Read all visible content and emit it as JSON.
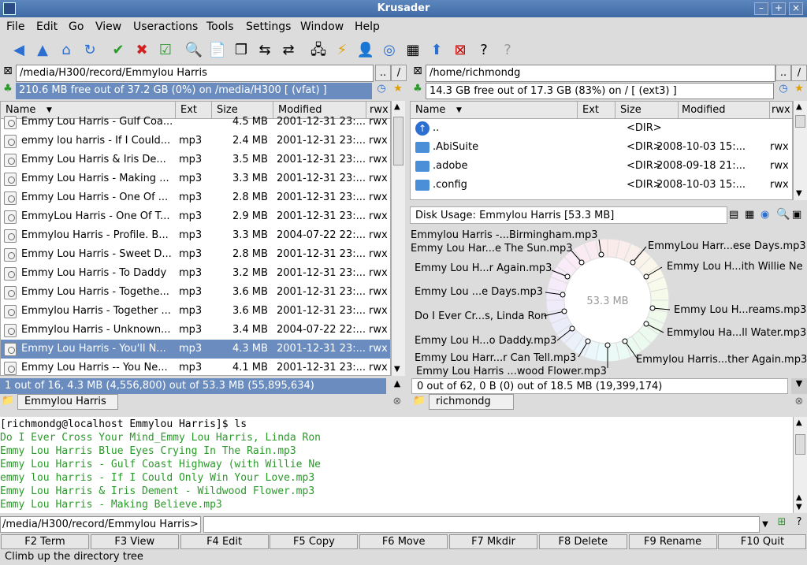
{
  "window": {
    "title": "Krusader"
  },
  "menu": [
    "File",
    "Edit",
    "Go",
    "View",
    "Useractions",
    "Tools",
    "Settings",
    "Window",
    "Help"
  ],
  "left": {
    "path": "/media/H300/record/Emmylou Harris",
    "free": "210.6 MB free out of 37.2 GB (0%) on /media/H300 [ (vfat) ]",
    "headers": {
      "name": "Name",
      "ext": "Ext",
      "size": "Size",
      "modified": "Modified",
      "rwx": "rwx"
    },
    "rows": [
      {
        "name": "Emmy Lou Harris - Gulf Coa...",
        "ext": "",
        "size": "4.5 MB",
        "modified": "2001-12-31 23:...",
        "rwx": "rwx"
      },
      {
        "name": "emmy lou harris - If I Could...",
        "ext": "mp3",
        "size": "2.4 MB",
        "modified": "2001-12-31 23:...",
        "rwx": "rwx"
      },
      {
        "name": "Emmy Lou Harris & Iris De...",
        "ext": "mp3",
        "size": "3.5 MB",
        "modified": "2001-12-31 23:...",
        "rwx": "rwx"
      },
      {
        "name": "Emmy Lou Harris - Making ...",
        "ext": "mp3",
        "size": "3.3 MB",
        "modified": "2001-12-31 23:...",
        "rwx": "rwx"
      },
      {
        "name": "Emmy Lou Harris - One Of ...",
        "ext": "mp3",
        "size": "2.8 MB",
        "modified": "2001-12-31 23:...",
        "rwx": "rwx"
      },
      {
        "name": "EmmyLou Harris - One Of T...",
        "ext": "mp3",
        "size": "2.9 MB",
        "modified": "2001-12-31 23:...",
        "rwx": "rwx"
      },
      {
        "name": "Emmylou Harris - Profile. B...",
        "ext": "mp3",
        "size": "3.3 MB",
        "modified": "2004-07-22 22:...",
        "rwx": "rwx"
      },
      {
        "name": "Emmy Lou Harris - Sweet D...",
        "ext": "mp3",
        "size": "2.8 MB",
        "modified": "2001-12-31 23:...",
        "rwx": "rwx"
      },
      {
        "name": "Emmy Lou Harris - To Daddy",
        "ext": "mp3",
        "size": "3.2 MB",
        "modified": "2001-12-31 23:...",
        "rwx": "rwx"
      },
      {
        "name": "Emmy Lou Harris - Togethe...",
        "ext": "mp3",
        "size": "3.6 MB",
        "modified": "2001-12-31 23:...",
        "rwx": "rwx"
      },
      {
        "name": "Emmylou Harris - Together ...",
        "ext": "mp3",
        "size": "3.6 MB",
        "modified": "2001-12-31 23:...",
        "rwx": "rwx"
      },
      {
        "name": "Emmylou Harris - Unknown...",
        "ext": "mp3",
        "size": "3.4 MB",
        "modified": "2004-07-22 22:...",
        "rwx": "rwx"
      },
      {
        "name": "Emmy Lou Harris -  You'll N...",
        "ext": "mp3",
        "size": "4.3 MB",
        "modified": "2001-12-31 23:...",
        "rwx": "rwx"
      },
      {
        "name": "Emmy Lou Harris -- You Ne...",
        "ext": "mp3",
        "size": "4.1 MB",
        "modified": "2001-12-31 23:...",
        "rwx": "rwx"
      }
    ],
    "status": "1 out of 16, 4.3 MB (4,556,800) out of 53.3 MB (55,895,634)",
    "tab": "Emmylou Harris"
  },
  "right": {
    "path": "/home/richmondg",
    "free": "14.3 GB free out of 17.3 GB (83%) on / [ (ext3) ]",
    "headers": {
      "name": "Name",
      "ext": "Ext",
      "size": "Size",
      "modified": "Modified",
      "rwx": "rwx"
    },
    "rows": [
      {
        "name": "..",
        "ext": "",
        "size": "<DIR>",
        "modified": "",
        "rwx": ""
      },
      {
        "name": ".AbiSuite",
        "ext": "",
        "size": "<DIR>",
        "modified": "2008-10-03 15:...",
        "rwx": "rwx"
      },
      {
        "name": ".adobe",
        "ext": "",
        "size": "<DIR>",
        "modified": "2008-09-18 21:...",
        "rwx": "rwx"
      },
      {
        "name": ".config",
        "ext": "",
        "size": "<DIR>",
        "modified": "2008-10-03 15:...",
        "rwx": "rwx"
      }
    ],
    "disk_usage": "Disk Usage: Emmylou Harris  [53.3 MB]",
    "pie_center": "53.3 MB",
    "pie_labels": [
      "Emmylou Harris -...Birmingham.mp3",
      "Emmy Lou Har...e The Sun.mp3",
      "Emmy Lou H...r Again.mp3",
      "Emmy Lou ...e Days.mp3",
      "Do I Ever Cr...s, Linda Ron",
      "Emmy Lou H...o Daddy.mp3",
      "Emmy Lou Harr...r Can Tell.mp3",
      "Emmy Lou Harris ...wood Flower.mp3",
      "EmmyLou Harr...ese Days.mp3",
      "Emmy Lou H...ith Willie Ne",
      "Emmy Lou H...reams.mp3",
      "Emmylou Ha...ll Water.mp3",
      "Emmylou Harris...ther Again.mp3"
    ],
    "status": "0 out of 62, 0 B (0) out of 18.5 MB (19,399,174)",
    "tab": "richmondg"
  },
  "terminal": {
    "lines": [
      {
        "text": "[richmondg@localhost Emmylou Harris]$ ls",
        "color": "#000000"
      },
      {
        "text": "Do I Ever Cross Your Mind_Emmy Lou Harris, Linda Ron",
        "color": "#2a9a2a"
      },
      {
        "text": "Emmy Lou Harris Blue Eyes Crying In The Rain.mp3",
        "color": "#2a9a2a"
      },
      {
        "text": "Emmy Lou Harris - Gulf Coast Highway (with Willie Ne",
        "color": "#2a9a2a"
      },
      {
        "text": "emmy lou harris - If I Could Only Win Your Love.mp3",
        "color": "#2a9a2a"
      },
      {
        "text": "Emmy Lou Harris & Iris Dement - Wildwood Flower.mp3",
        "color": "#2a9a2a"
      },
      {
        "text": "Emmy Lou Harris - Making Believe.mp3",
        "color": "#2a9a2a"
      }
    ]
  },
  "cmdline": {
    "prompt": "/media/H300/record/Emmylou Harris>",
    "value": ""
  },
  "fkeys": [
    "F2 Term",
    "F3 View",
    "F4 Edit",
    "F5 Copy",
    "F6 Move",
    "F7 Mkdir",
    "F8 Delete",
    "F9 Rename",
    "F10 Quit"
  ],
  "statusbar": "Climb up the directory tree",
  "small": {
    "up": "..",
    "root": "/"
  }
}
